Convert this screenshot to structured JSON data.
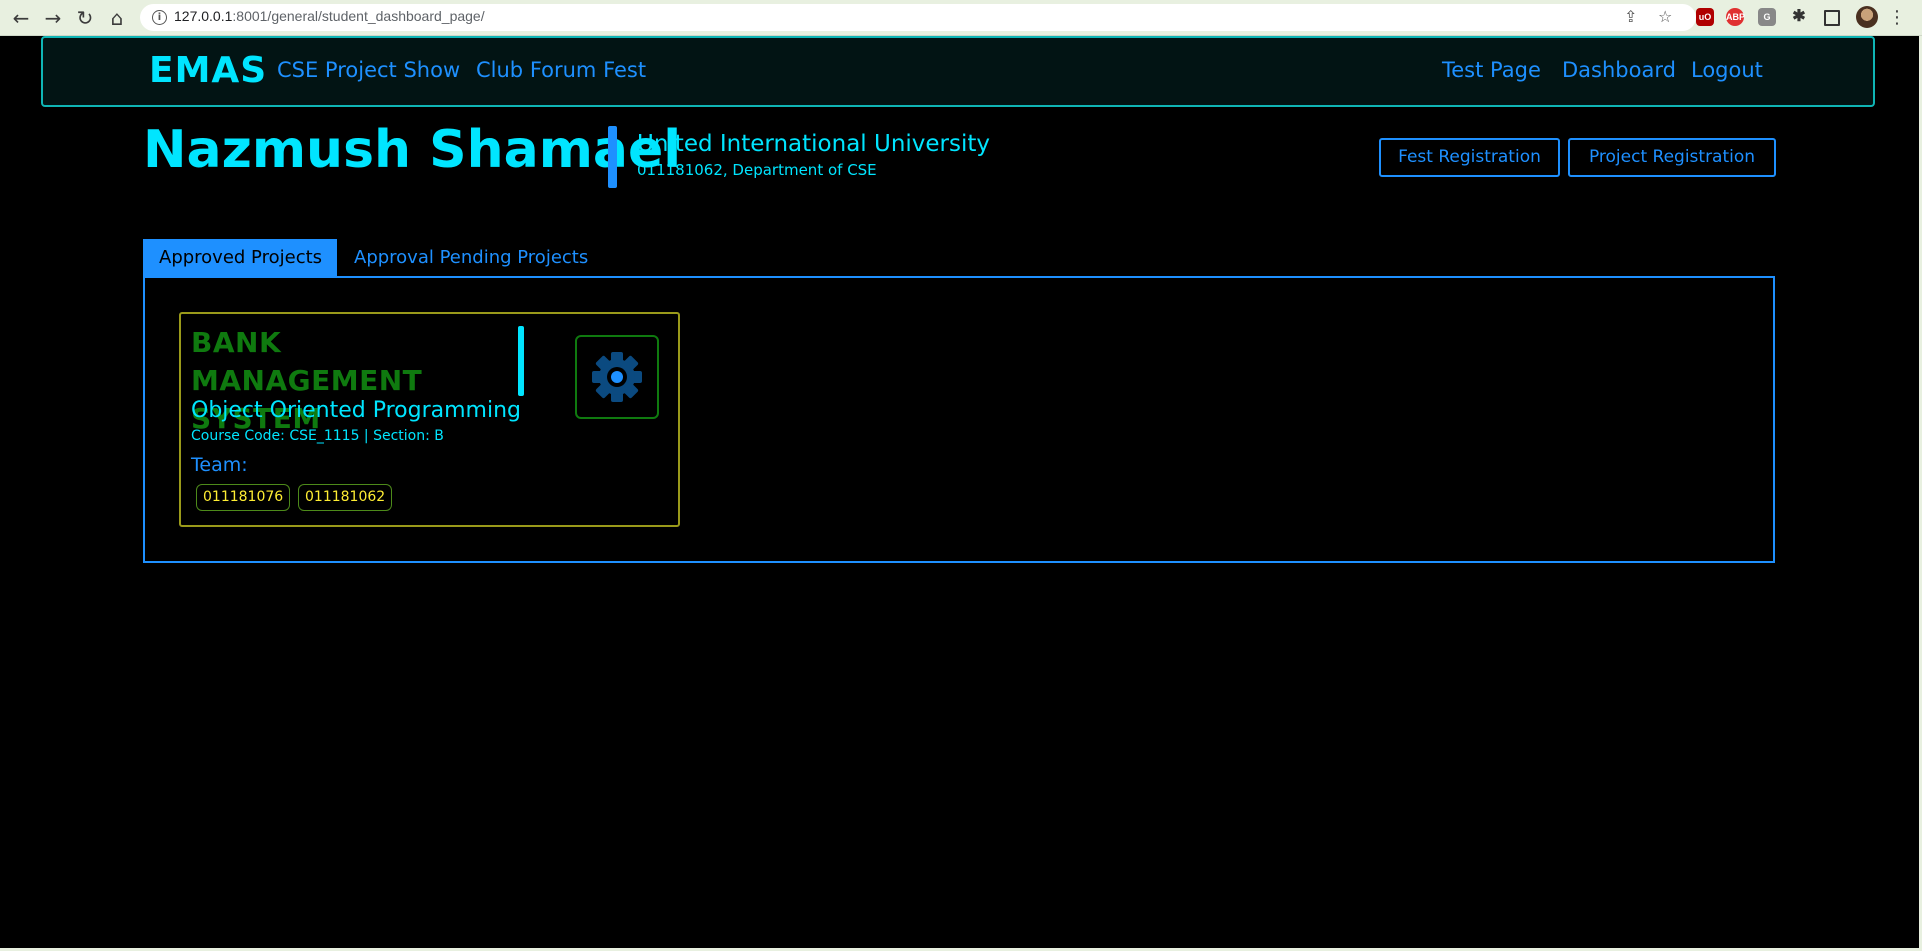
{
  "browser": {
    "url_host": "127.0.0.1",
    "url_rest": ":8001/general/student_dashboard_page/",
    "ext_ublock": "uO",
    "ext_abp": "ABP",
    "ext_g": "G"
  },
  "navbar": {
    "brand": "EMAS",
    "left_links": [
      "CSE Project Show",
      "Club Forum Fest"
    ],
    "right_links": [
      "Test Page",
      "Dashboard",
      "Logout"
    ]
  },
  "student": {
    "name": "Nazmush Shamael",
    "university": "United International University",
    "meta": "011181062, Department of CSE"
  },
  "actions": {
    "fest_registration": "Fest Registration",
    "project_registration": "Project Registration"
  },
  "tabs": {
    "approved": "Approved Projects",
    "pending": "Approval Pending Projects"
  },
  "project": {
    "title": "BANK MANAGEMENT SYSTEM",
    "course": "Object Oriented Programming",
    "course_meta": "Course Code: CSE_1115 | Section: B",
    "team_label": "Team:",
    "members": [
      "011181076",
      "011181062"
    ],
    "icon": "gear-icon"
  },
  "colors": {
    "accent_cyan": "#00e5ff",
    "accent_blue": "#1e90ff",
    "title_green": "#0f7a0f",
    "member_yellow": "#ffee33",
    "card_border": "#9a9a1a"
  }
}
